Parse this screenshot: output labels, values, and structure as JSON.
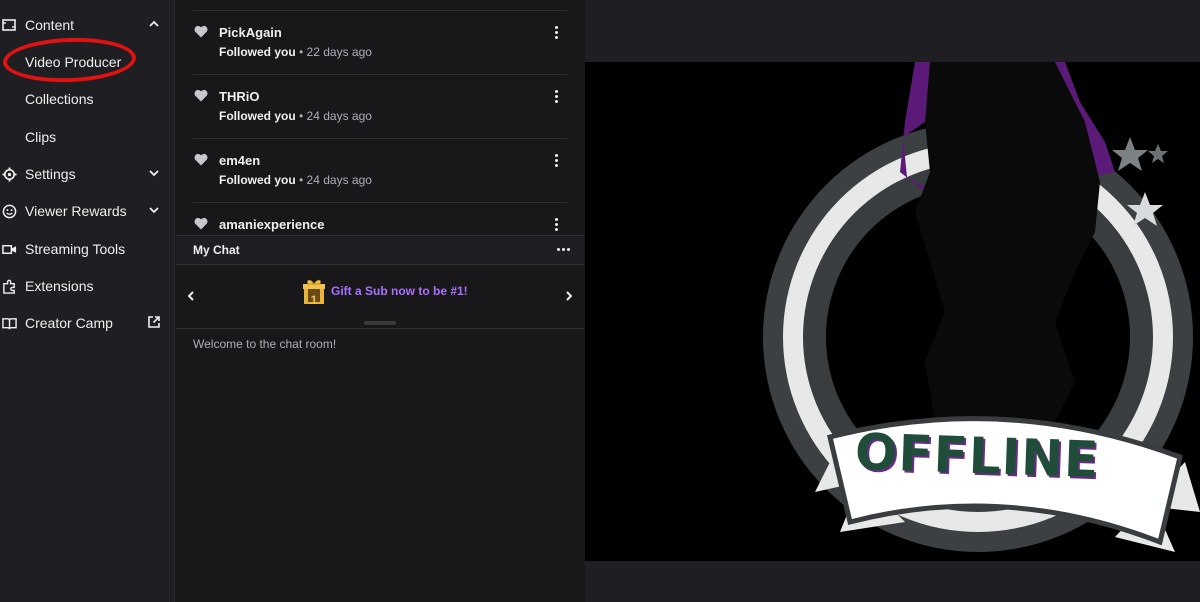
{
  "sidebar": {
    "items": [
      {
        "label": "Content",
        "icon": "content-icon",
        "chevron": "up"
      },
      {
        "label": "Video Producer",
        "sub": true
      },
      {
        "label": "Collections",
        "sub": true
      },
      {
        "label": "Clips",
        "sub": true
      },
      {
        "label": "Settings",
        "icon": "gear-icon",
        "chevron": "down"
      },
      {
        "label": "Viewer Rewards",
        "icon": "smile-icon",
        "chevron": "down"
      },
      {
        "label": "Streaming Tools",
        "icon": "camera-icon"
      },
      {
        "label": "Extensions",
        "icon": "puzzle-icon"
      },
      {
        "label": "Creator Camp",
        "icon": "book-icon",
        "external": true
      }
    ],
    "annotation_color": "#e01212"
  },
  "followers": [
    {
      "name": "PickAgain",
      "action": "Followed you",
      "time": "22 days ago"
    },
    {
      "name": "THRiO",
      "action": "Followed you",
      "time": "24 days ago"
    },
    {
      "name": "em4en",
      "action": "Followed you",
      "time": "24 days ago"
    },
    {
      "name": "amaniexperience",
      "action": "",
      "time": ""
    }
  ],
  "chat": {
    "title": "My Chat",
    "promo_text": "Gift a Sub now to be #1!",
    "gift_badge": "1",
    "welcome": "Welcome to the chat room!"
  },
  "video": {
    "status": "OFFLINE"
  },
  "colors": {
    "accent": "#a970ff",
    "background": "#18181b",
    "panel": "#1f1f23"
  }
}
